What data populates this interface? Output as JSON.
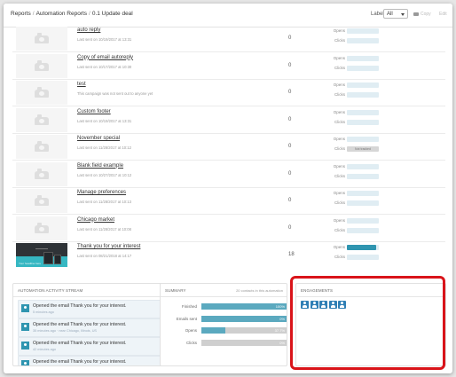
{
  "breadcrumb": [
    "Reports",
    "Automation Reports",
    "0.1 Update deal"
  ],
  "toolbar": {
    "label_text": "Label",
    "label_select_value": "All",
    "copy_label": "Copy",
    "edit_label": "Edit"
  },
  "metric_labels": {
    "opens": "Opens",
    "clicks": "Clicks",
    "not_tracked": "Not tracked"
  },
  "campaigns": [
    {
      "title": "auto reply",
      "subtitle": "Last sent on 10/19/2017 at 13:31",
      "count": "0",
      "opens": 0,
      "clicks": 0
    },
    {
      "title": "Copy of email autoreply",
      "subtitle": "Last sent on 10/17/2017 at 10:30",
      "count": "0",
      "opens": 0,
      "clicks": 0
    },
    {
      "title": "test",
      "subtitle": "This campaign was not sent out to anyone yet",
      "count": "0",
      "opens": 0,
      "clicks": 0
    },
    {
      "title": "Custom footer",
      "subtitle": "Last sent on 10/19/2017 at 13:31",
      "count": "0",
      "opens": 0,
      "clicks": 0
    },
    {
      "title": "November special",
      "subtitle": "Last sent on 11/28/2017 at 10:12",
      "count": "0",
      "opens": 0,
      "clicks_not_tracked": true
    },
    {
      "title": "Blank field example",
      "subtitle": "Last sent on 10/27/2017 at 10:12",
      "count": "0",
      "opens": 0,
      "clicks": 0
    },
    {
      "title": "Manage preferences",
      "subtitle": "Last sent on 11/28/2017 at 10:13",
      "count": "0",
      "opens": 0,
      "clicks": 0
    },
    {
      "title": "Chicago market",
      "subtitle": "Last sent on 11/28/2017 at 10:08",
      "count": "0",
      "opens": 0,
      "clicks": 0
    },
    {
      "title": "Thank you for your interest",
      "subtitle": "Last sent on 08/21/2018 at 14:17",
      "count": "18",
      "opens": 0.92,
      "clicks": 0,
      "has_image": true,
      "thumb_text": "Your headline here"
    }
  ],
  "activity": {
    "title": "AUTOMATION ACTIVITY STREAM",
    "items": [
      {
        "text": "Opened the email Thank you for your interest.",
        "meta": "5 minutes ago"
      },
      {
        "text": "Opened the email Thank you for your interest.",
        "meta": "35 minutes ago · near Chicago, Illinois, US"
      },
      {
        "text": "Opened the email Thank you for your interest.",
        "meta": "42 minutes ago"
      },
      {
        "text": "Opened the email Thank you for your interest.",
        "meta": ""
      }
    ]
  },
  "summary": {
    "title": "SUMMARY",
    "note": "20 contacts in this automation",
    "rows": [
      {
        "label": "Finished",
        "value": 1.0,
        "pct": "100%"
      },
      {
        "label": "Emails sent",
        "value": 1.0,
        "pct": "0%"
      },
      {
        "label": "Opens",
        "value": 0.28,
        "pct": "37.7%"
      },
      {
        "label": "Clicks",
        "value": 0.0,
        "pct": "0%"
      }
    ]
  },
  "engagements": {
    "title": "ENGAGEMENTS",
    "icon_count": 5
  },
  "colors": {
    "accent": "#2f95b0",
    "highlight": "#d9141a"
  }
}
